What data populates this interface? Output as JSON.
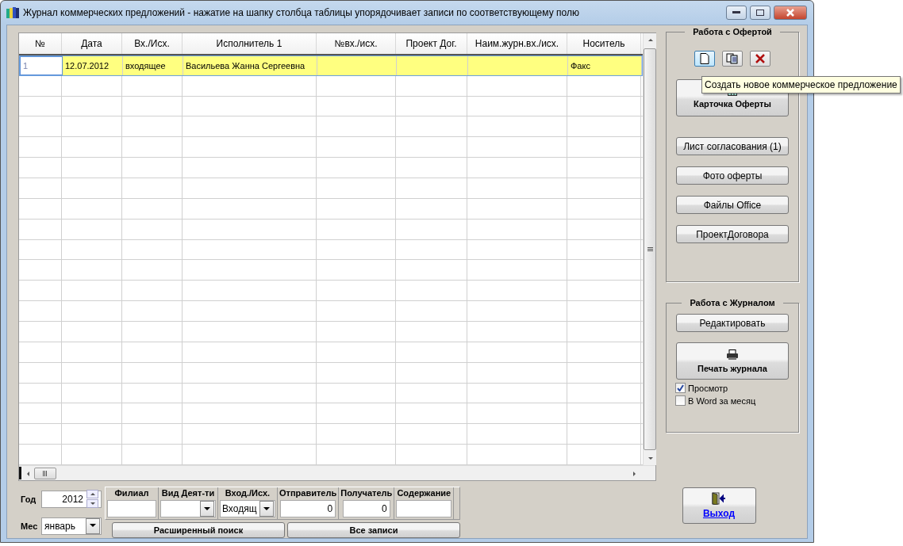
{
  "window": {
    "title": "Журнал коммерческих предложений - нажатие на шапку столбца таблицы упорядочивает записи по соответствующему полю"
  },
  "table": {
    "columns": [
      "№",
      "Дата",
      "Вх./Исх.",
      "Исполнитель 1",
      "№вх./исх.",
      "Проект Дог.",
      "Наим.журн.вх./исх.",
      "Носитель"
    ],
    "rows": [
      {
        "number": "1",
        "date": "12.07.2012",
        "direction": "входящее",
        "executor": "Васильева Жанна Сергеевна",
        "carrier": "Факс",
        "selected": true
      }
    ]
  },
  "offer_panel": {
    "title": "Работа с Офертой",
    "icon_buttons": [
      {
        "kind": "new",
        "hovered": true
      },
      {
        "kind": "copy",
        "hovered": false
      },
      {
        "kind": "delete",
        "hovered": false
      }
    ],
    "card_button": "Карточка Оферты",
    "buttons": [
      "Лист согласования (1)",
      "Фото оферты",
      "Файлы Office",
      "ПроектДоговора"
    ]
  },
  "journal_panel": {
    "title": "Работа с Журналом",
    "edit_button": "Редактировать",
    "print_button": "Печать журнала",
    "checkboxes": [
      {
        "label": "Просмотр",
        "checked": true
      },
      {
        "label": "В Word за месяц",
        "checked": false
      }
    ]
  },
  "filters": {
    "year_label": "Год",
    "year": "2012",
    "month_label": "Мес",
    "month": "январь",
    "fields": [
      {
        "label": "Филиал",
        "kind": "text"
      },
      {
        "label": "Вид Деят-ти",
        "kind": "dropdown"
      },
      {
        "label": "Вход./Исх.",
        "kind": "dropdown",
        "value": "Входящ"
      },
      {
        "label": "Отправитель",
        "kind": "text",
        "value": "0"
      },
      {
        "label": "Получатель",
        "kind": "text",
        "value": "0"
      },
      {
        "label": "Содержание",
        "kind": "text"
      }
    ],
    "buttons": [
      "Расширенный поиск",
      "Все записи"
    ]
  },
  "exit_button": "Выход",
  "tooltip": "Создать новое коммерческое предложение"
}
